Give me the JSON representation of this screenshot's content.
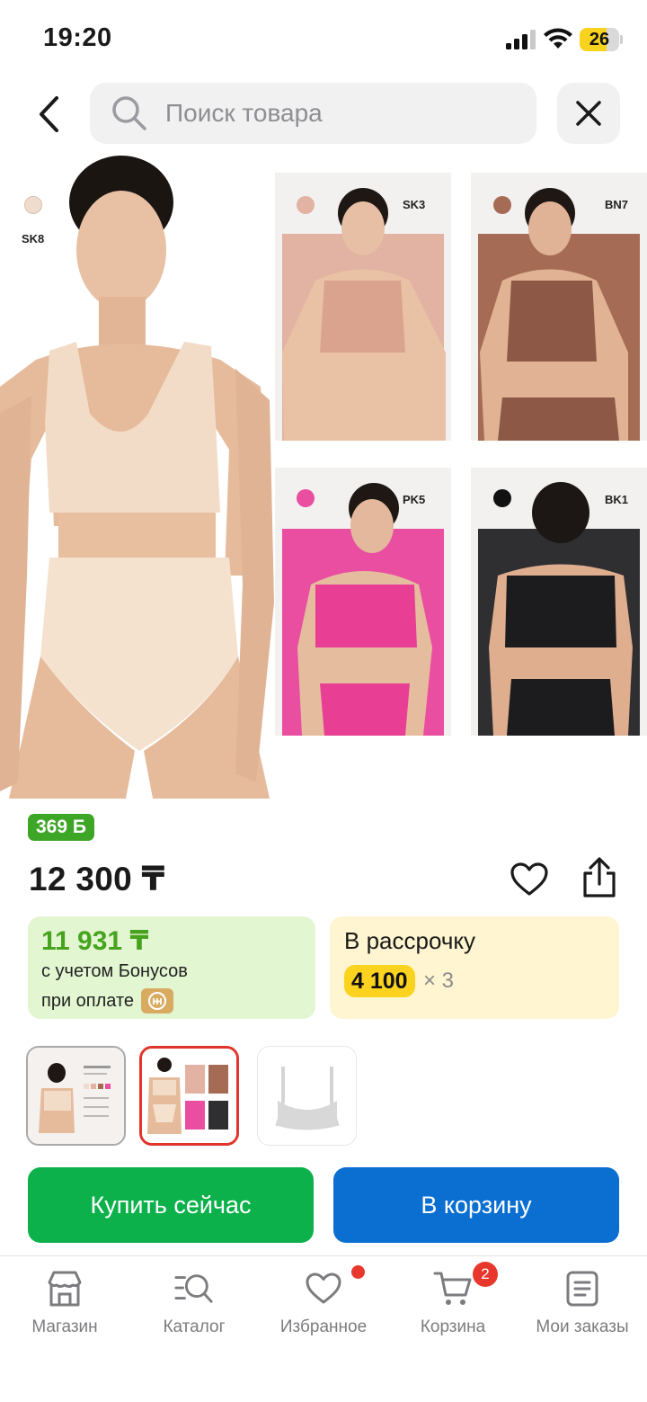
{
  "status_bar": {
    "time": "19:20",
    "battery": "26"
  },
  "header": {
    "search_placeholder": "Поиск товара"
  },
  "product_image": {
    "main_code": "SK8",
    "variants": [
      {
        "code": "SK3",
        "color": "#e2b2a2"
      },
      {
        "code": "BN7",
        "color": "#a56b55"
      },
      {
        "code": "PK5",
        "color": "#e94ea0"
      },
      {
        "code": "BK1",
        "color": "#2f2f31"
      }
    ],
    "main_swatch_color": "#f0dccd"
  },
  "price": {
    "bonus_badge": "369 Б",
    "price": "12 300 ₸"
  },
  "bonus_card": {
    "price": "11 931 ₸",
    "line1": "с учетом Бонусов",
    "line2": "при оплате"
  },
  "installment": {
    "title": "В рассрочку",
    "amount": "4 100",
    "multiplier": "× 3"
  },
  "actions": {
    "buy_now": "Купить сейчас",
    "add_to_cart": "В корзину"
  },
  "bottom_nav": {
    "items": [
      {
        "label": "Магазин"
      },
      {
        "label": "Каталог"
      },
      {
        "label": "Избранное"
      },
      {
        "label": "Корзина",
        "badge": "2"
      },
      {
        "label": "Мои заказы"
      }
    ]
  },
  "colors": {
    "green_accent": "#0db14b",
    "blue_accent": "#0b6fd1",
    "bonus_green": "#47a31f",
    "badge_red": "#e8372c",
    "installment_yellow": "#fbd31f"
  }
}
